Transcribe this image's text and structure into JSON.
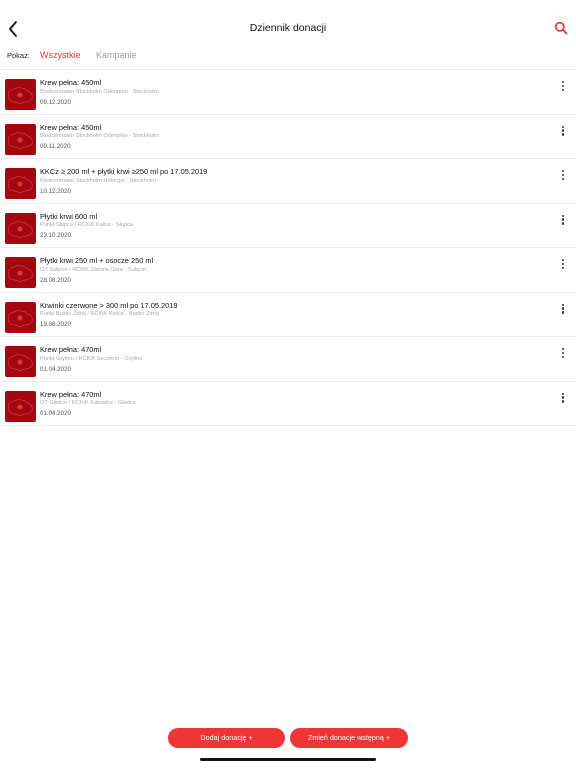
{
  "header": {
    "title": "Dziennik donacji",
    "back_icon": "chevron-left-icon",
    "search_icon": "search-icon",
    "accent_color": "#e53935"
  },
  "filter": {
    "label": "Pokaż:",
    "tabs": [
      {
        "label": "Wszystkie",
        "active": true
      },
      {
        "label": "Kampanie",
        "active": false
      }
    ]
  },
  "donations": [
    {
      "title": "Krew pełna: 450ml",
      "place": "Blodcentralen Stockholm Odenplan - Stockholm",
      "date": "09.12.2020"
    },
    {
      "title": "Krew pełna: 450ml",
      "place": "Blodcentralen Stockholm Odenplan - Stockholm",
      "date": "09.11.2020"
    },
    {
      "title": "KKCz ≥ 200 ml + płytki krwi ≥250 ml po 17.05.2019",
      "place": "Blodcentralen Stockholm Hötorget - Stockholm",
      "date": "10.12.2020"
    },
    {
      "title": "Płytki krwi 600 ml",
      "place": "Punkt Słupca / RCKiK Kalisz - Słupca",
      "date": "23.10.2020"
    },
    {
      "title": "Płytki krwi 250 ml + osocze 250 ml",
      "place": "OT Sulęcin / RCKiK Zielona Góra - Sulęcin",
      "date": "28.08.2020"
    },
    {
      "title": "Krwinki czerwone > 300 ml po 17.05.2019",
      "place": "Punkt Busko Zdrój / RCKiK Kielce - Busko Zdrój",
      "date": "19.08.2020"
    },
    {
      "title": "Krew pełna: 470ml",
      "place": "Punkt Gryfino / RCKiK Szczecin - Gryfino",
      "date": "01.04.2020"
    },
    {
      "title": "Krew pełna: 470ml",
      "place": "OT Gliwice / RCKiK Katowice - Gliwice",
      "date": "01.04.2020"
    }
  ],
  "actions": {
    "add_donation": "Dodaj donację +",
    "change_initial": "Zmień donacje wstępną +"
  }
}
